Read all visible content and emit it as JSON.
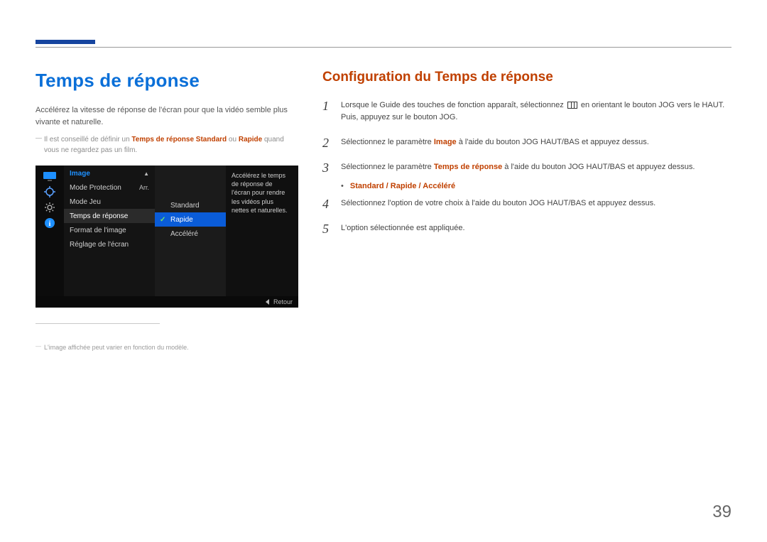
{
  "page_number": "39",
  "left": {
    "heading": "Temps de réponse",
    "intro": "Accélérez la vitesse de réponse de l'écran pour que la vidéo semble plus vivante et naturelle.",
    "note_pre": "Il est conseillé de définir un ",
    "note_em": "Temps de réponse Standard",
    "note_mid": " ou ",
    "note_em2": "Rapide",
    "note_post": " quand vous ne regardez pas un film.",
    "footnote": "L'image affichée peut varier en fonction du modèle."
  },
  "osd": {
    "menu_title": "Image",
    "items": [
      {
        "label": "Mode Protection",
        "value": "Arr."
      },
      {
        "label": "Mode Jeu",
        "value": ""
      },
      {
        "label": "Temps de réponse",
        "value": ""
      },
      {
        "label": "Format de l'image",
        "value": ""
      },
      {
        "label": "Réglage de l'écran",
        "value": ""
      }
    ],
    "options": [
      "Standard",
      "Rapide",
      "Accéléré"
    ],
    "selected_option_index": 1,
    "highlighted_item_index": 2,
    "desc": "Accélérez le temps de réponse de l'écran pour rendre les vidéos plus nettes et naturelles.",
    "footer": "Retour"
  },
  "right": {
    "heading": "Configuration du Temps de réponse",
    "step1_a": "Lorsque le Guide des touches de fonction apparaît, sélectionnez ",
    "step1_b": " en orientant le bouton JOG vers le HAUT. Puis, appuyez sur le bouton JOG.",
    "step2_a": "Sélectionnez le paramètre ",
    "step2_em": "Image",
    "step2_b": " à l'aide du bouton JOG HAUT/BAS et appuyez dessus.",
    "step3_a": "Sélectionnez le paramètre ",
    "step3_em": "Temps de réponse",
    "step3_b": " à l'aide du bouton JOG HAUT/BAS et appuyez dessus.",
    "options_line": {
      "a": "Standard",
      "b": "Rapide",
      "c": "Accéléré"
    },
    "step4": "Sélectionnez l'option de votre choix à l'aide du bouton JOG HAUT/BAS et appuyez dessus.",
    "step5": "L'option sélectionnée est appliquée."
  }
}
